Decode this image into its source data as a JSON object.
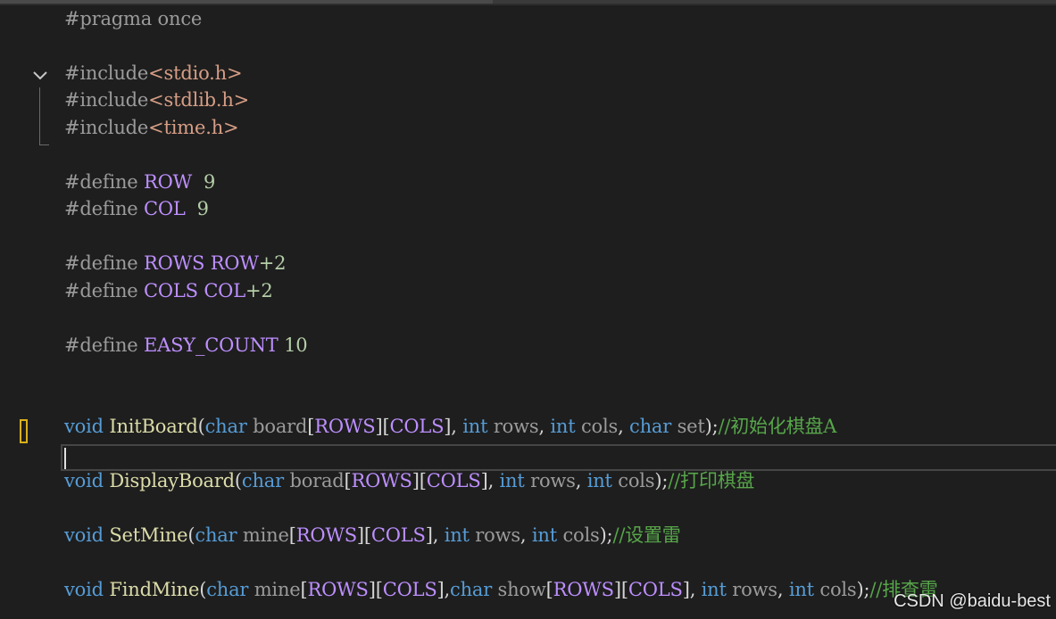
{
  "code": {
    "line_pragma": {
      "directive": "#pragma",
      "rest": " once"
    },
    "include1": {
      "directive": "#include",
      "header": "<stdio.h>"
    },
    "include2": {
      "directive": "#include",
      "header": "<stdlib.h>"
    },
    "include3": {
      "directive": "#include",
      "header": "<time.h>"
    },
    "define_row": {
      "directive": "#define",
      "name": "ROW",
      "value": "9"
    },
    "define_col": {
      "directive": "#define",
      "name": "COL",
      "value": "9"
    },
    "define_rows": {
      "directive": "#define",
      "name": "ROWS",
      "ref": "ROW",
      "suffix": "+2"
    },
    "define_cols": {
      "directive": "#define",
      "name": "COLS",
      "ref": "COL",
      "suffix": "+2"
    },
    "define_easy": {
      "directive": "#define",
      "name": "EASY_COUNT",
      "value": "10"
    },
    "decl_init": {
      "ret": "void",
      "name": "InitBoard",
      "t1": "char",
      "p1": "board",
      "m1": "ROWS",
      "m2": "COLS",
      "t2": "int",
      "p2": "rows",
      "t3": "int",
      "p3": "cols",
      "t4": "char",
      "p4": "set",
      "comment": "//初始化棋盘A"
    },
    "decl_display": {
      "ret": "void",
      "name": "DisplayBoard",
      "t1": "char",
      "p1": "borad",
      "m1": "ROWS",
      "m2": "COLS",
      "t2": "int",
      "p2": "rows",
      "t3": "int",
      "p3": "cols",
      "comment": "//打印棋盘"
    },
    "decl_setmine": {
      "ret": "void",
      "name": "SetMine",
      "t1": "char",
      "p1": "mine",
      "m1": "ROWS",
      "m2": "COLS",
      "t2": "int",
      "p2": "rows",
      "t3": "int",
      "p3": "cols",
      "comment": "//设置雷"
    },
    "decl_findmine": {
      "ret": "void",
      "name": "FindMine",
      "t1": "char",
      "p1": "mine",
      "m1": "ROWS",
      "m2": "COLS",
      "t2": "char",
      "p2": "show",
      "m3": "ROWS",
      "m4": "COLS",
      "t3": "int",
      "p3": "rows",
      "t4": "int",
      "p4": "cols",
      "comment": "//排查雷"
    }
  },
  "icons": {
    "fold": "chevron-down-icon",
    "bookmark": "bookmark-icon"
  },
  "watermark": "CSDN @baidu-best",
  "colors": {
    "background": "#1e1e1e",
    "keyword": "#569cd6",
    "function": "#dcdcaa",
    "macro": "#bd8fff",
    "string": "#d69d85",
    "number": "#b5cea8",
    "comment": "#57a64a",
    "preprocessor": "#9b9b9b"
  }
}
